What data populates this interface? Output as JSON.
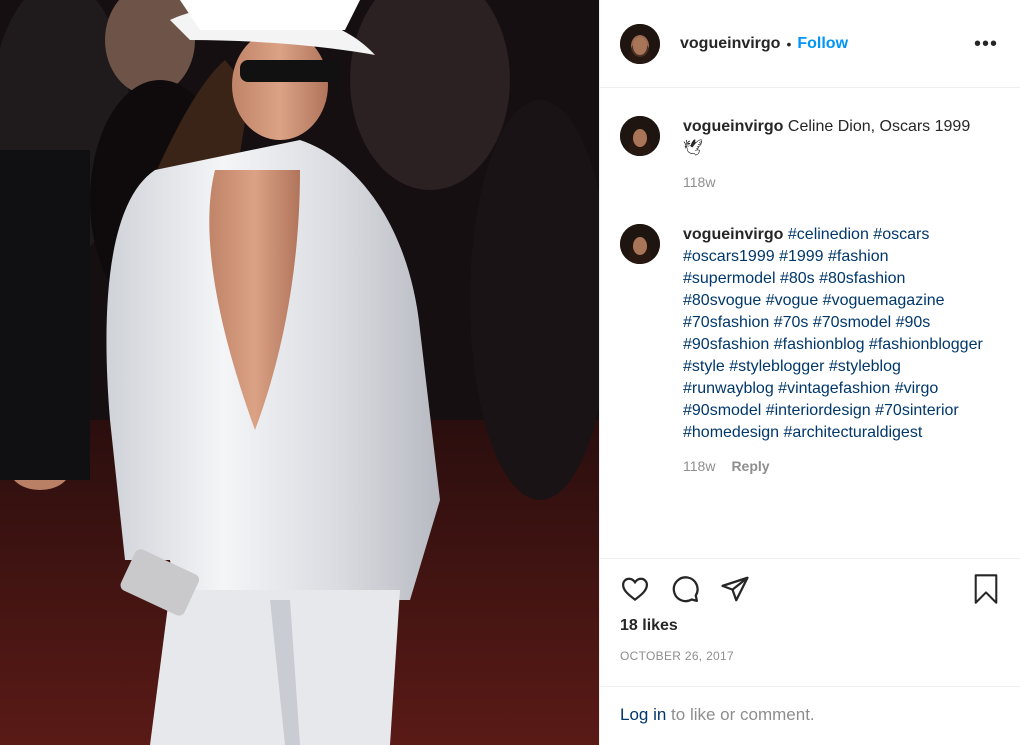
{
  "post": {
    "username": "vogueinvirgo",
    "separator": "•",
    "follow_label": "Follow",
    "more_label": "•••",
    "likes": "18 likes",
    "date": "OCTOBER 26, 2017"
  },
  "comments": [
    {
      "username": "vogueinvirgo",
      "text": " Celine Dion, Oscars 1999 🕊",
      "time": "118w"
    },
    {
      "username": "vogueinvirgo",
      "text": " #celinedion #oscars #oscars1999 #1999 #fashion #supermodel #80s #80sfashion #80svogue #vogue #voguemagazine #70sfashion #70s #70smodel #90s #90sfashion #fashionblog #fashionblogger #style #styleblogger #styleblog #runwayblog #vintagefashion #virgo #90smodel #interiordesign #70sinterior #homedesign #architecturaldigest",
      "time": "118w",
      "reply_label": "Reply"
    }
  ],
  "login": {
    "link_label": "Log in",
    "rest_label": " to like or comment."
  },
  "icons": {
    "like": "heart-icon",
    "comment": "speech-bubble-icon",
    "share": "paper-plane-icon",
    "save": "bookmark-icon"
  }
}
